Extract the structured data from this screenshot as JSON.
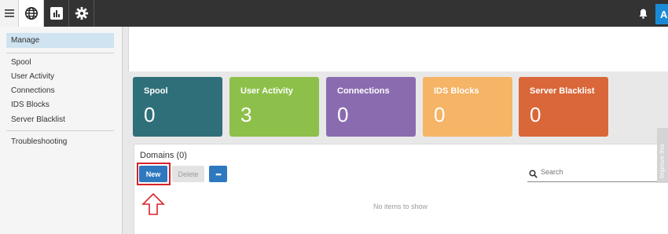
{
  "topbar": {
    "tabs": [
      {
        "icon": "globe-icon",
        "active": true
      },
      {
        "icon": "bar-chart-icon",
        "active": false
      },
      {
        "icon": "gear-icon",
        "active": false
      }
    ],
    "avatar_initial": "A"
  },
  "sidebar": {
    "active_item": "Manage",
    "items": [
      "Spool",
      "User Activity",
      "Connections",
      "IDS Blocks",
      "Server Blacklist"
    ],
    "footer_item": "Troubleshooting"
  },
  "tiles": [
    {
      "label": "Spool",
      "value": "0",
      "color": "#2f6f7a"
    },
    {
      "label": "User Activity",
      "value": "3",
      "color": "#8dc04a"
    },
    {
      "label": "Connections",
      "value": "0",
      "color": "#8a6bb0"
    },
    {
      "label": "IDS Blocks",
      "value": "0",
      "color": "#f5b466"
    },
    {
      "label": "Server Blacklist",
      "value": "0",
      "color": "#d9673a"
    }
  ],
  "domains": {
    "title": "Domains (0)",
    "new_label": "New",
    "delete_label": "Delete",
    "more_label": "•••",
    "search_placeholder": "Search",
    "empty_text": "No items to show"
  },
  "side_tab_label": "Improve this"
}
